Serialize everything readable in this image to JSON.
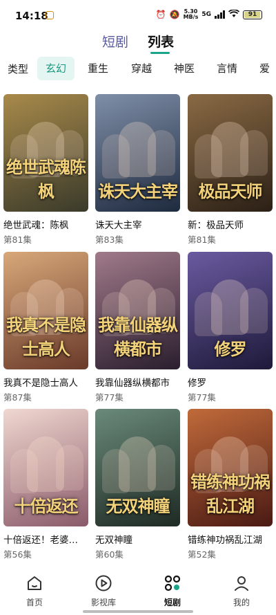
{
  "status": {
    "time": "14:18",
    "speed_value": "5.30",
    "speed_unit": "MB/s",
    "network": "5G",
    "battery": "91"
  },
  "top_tabs": [
    {
      "label": "短剧",
      "active": false
    },
    {
      "label": "列表",
      "active": true
    }
  ],
  "accent_color": "#1aa58a",
  "categories": {
    "label": "类型",
    "items": [
      "玄幻",
      "重生",
      "穿越",
      "神医",
      "言情",
      "爱"
    ],
    "selected": "玄幻"
  },
  "cards": [
    {
      "title": "绝世武魂：陈枫",
      "episodes": "第81集",
      "poster_text": "绝世武魂陈枫",
      "colors": [
        "#3a3a2a",
        "#a88a4a"
      ]
    },
    {
      "title": "诛天大主宰",
      "episodes": "第83集",
      "poster_text": "诛天大主宰",
      "colors": [
        "#1e2a3e",
        "#7f8fa8"
      ]
    },
    {
      "title": "新：极品天师",
      "episodes": "第81集",
      "poster_text": "极品天师",
      "colors": [
        "#2b2016",
        "#8a6a44"
      ]
    },
    {
      "title": "我真不是隐士高人",
      "episodes": "第87集",
      "poster_text": "我真不是隐士高人",
      "colors": [
        "#6a3a2a",
        "#d8a87a"
      ]
    },
    {
      "title": "我靠仙器纵横都市",
      "episodes": "第77集",
      "poster_text": "我靠仙器纵横都市",
      "colors": [
        "#2a1e2e",
        "#a07a8a"
      ]
    },
    {
      "title": "修罗",
      "episodes": "第77集",
      "poster_text": "修罗",
      "colors": [
        "#1e1a3a",
        "#6a5aa0"
      ]
    },
    {
      "title": "十倍返还！老婆…",
      "episodes": "第56集",
      "poster_text": "十倍返还",
      "colors": [
        "#8a5a6a",
        "#f0d8d0"
      ]
    },
    {
      "title": "无双神瞳",
      "episodes": "第60集",
      "poster_text": "无双神瞳",
      "colors": [
        "#1e2a24",
        "#6a8a7a"
      ]
    },
    {
      "title": "错练神功祸乱江湖",
      "episodes": "第52集",
      "poster_text": "错练神功祸乱江湖",
      "colors": [
        "#4a1a14",
        "#c06a3a"
      ]
    }
  ],
  "bottom_nav": [
    {
      "label": "首页",
      "icon": "home-icon",
      "active": false
    },
    {
      "label": "影视库",
      "icon": "play-icon",
      "active": false
    },
    {
      "label": "短剧",
      "icon": "grid-icon",
      "active": true
    },
    {
      "label": "我的",
      "icon": "person-icon",
      "active": false
    }
  ]
}
